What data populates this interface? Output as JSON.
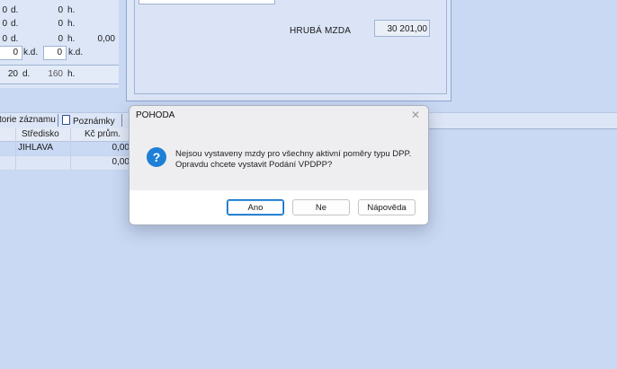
{
  "left_stats": [
    {
      "days": "0",
      "day_unit": "d.",
      "hours": "0",
      "hour_unit": "h.",
      "amount": ""
    },
    {
      "days": "0",
      "day_unit": "d.",
      "hours": "0",
      "hour_unit": "h.",
      "amount": ""
    },
    {
      "days": "0",
      "day_unit": "d.",
      "hours": "0",
      "hour_unit": "h.",
      "amount": "0,00"
    },
    {
      "days": "0",
      "day_unit": "k.d.",
      "hours": "0",
      "hour_unit": "k.d.",
      "amount": ""
    }
  ],
  "summary": {
    "days": "20",
    "day_unit": "d.",
    "hours": "160",
    "hour_unit": "h."
  },
  "gross_wage": {
    "label": "HRUBÁ MZDA",
    "value": "30 201,00"
  },
  "tabs": {
    "history_label": "torie záznamu",
    "notes_label": "Poznámky"
  },
  "grid": {
    "headers": {
      "center": "Středisko",
      "avg": "Kč prům."
    },
    "rows": [
      {
        "center": "JIHLAVA",
        "avg": "0,00"
      },
      {
        "center": "",
        "avg": "0,00"
      }
    ]
  },
  "dialog": {
    "title": "POHODA",
    "message_line1": "Nejsou vystaveny mzdy pro všechny aktivní poměry typu DPP.",
    "message_line2": "Opravdu chcete vystavit Podání VPDPP?",
    "buttons": {
      "yes": "Ano",
      "no": "Ne",
      "help": "Nápověda"
    }
  },
  "icons": {
    "question": "question-icon",
    "close": "close-icon",
    "notes": "document-icon"
  },
  "colors": {
    "app_background": "#c9d8f3",
    "dialog_accent": "#0067c0",
    "question_icon": "#1e7fd6"
  }
}
